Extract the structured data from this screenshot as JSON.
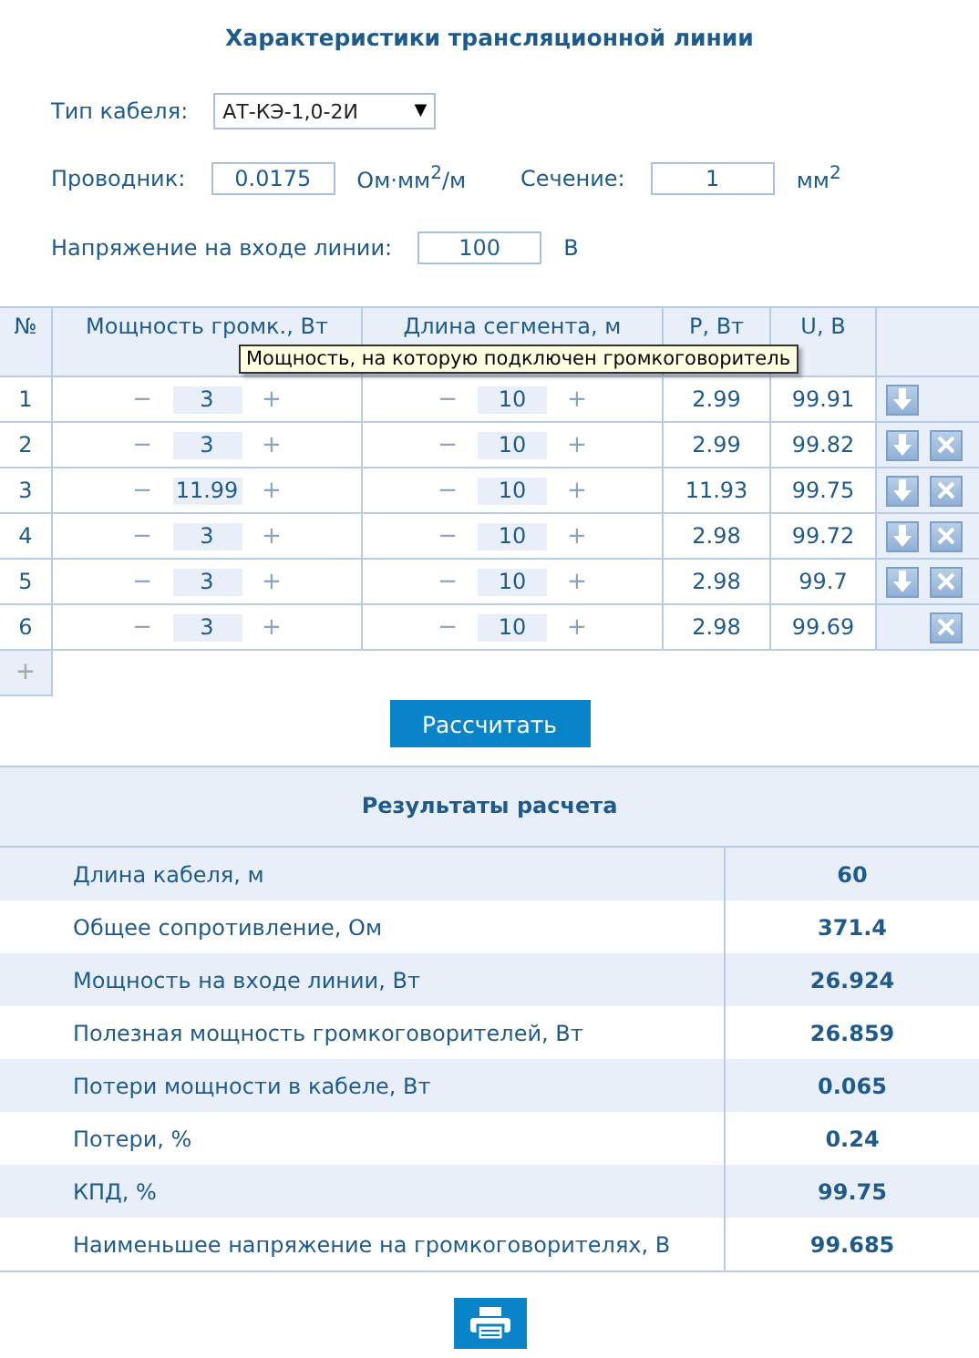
{
  "title": "Характеристики трансляционной линии",
  "cable": {
    "label": "Тип кабеля:",
    "value": "АТ-КЭ-1,0-2И",
    "caret": "▼"
  },
  "conductor": {
    "label": "Проводник:",
    "value": "0.0175",
    "unit": "Ом·мм$^{2}$/м"
  },
  "section": {
    "label": "Сечение:",
    "value": "1",
    "unit": "мм$^{2}$"
  },
  "voltage": {
    "label": "Напряжение на входе линии:",
    "value": "100",
    "unit": "В"
  },
  "table": {
    "columns": [
      "№",
      "Мощность громк., Вт",
      "Длина сегмента, м",
      "P, Вт",
      "U, В"
    ],
    "tooltip": "Мощность, на которую подключен громкоговоритель",
    "minus": "−",
    "plus": "+",
    "rows": [
      {
        "n": "1",
        "power": "3",
        "length": "10",
        "p": "2.99",
        "u": "99.91",
        "can_move_down": true,
        "can_delete": false
      },
      {
        "n": "2",
        "power": "3",
        "length": "10",
        "p": "2.99",
        "u": "99.82",
        "can_move_down": true,
        "can_delete": true
      },
      {
        "n": "3",
        "power": "11.99",
        "length": "10",
        "p": "11.93",
        "u": "99.75",
        "can_move_down": true,
        "can_delete": true
      },
      {
        "n": "4",
        "power": "3",
        "length": "10",
        "p": "2.98",
        "u": "99.72",
        "can_move_down": true,
        "can_delete": true
      },
      {
        "n": "5",
        "power": "3",
        "length": "10",
        "p": "2.98",
        "u": "99.7",
        "can_move_down": true,
        "can_delete": true
      },
      {
        "n": "6",
        "power": "3",
        "length": "10",
        "p": "2.98",
        "u": "99.69",
        "can_move_down": false,
        "can_delete": true
      }
    ],
    "add": "+"
  },
  "calculate_button": "Рассчитать",
  "results": {
    "title": "Результаты расчета",
    "rows": [
      {
        "label": "Длина кабеля, м",
        "value": "60"
      },
      {
        "label": "Общее сопротивление, Ом",
        "value": "371.4"
      },
      {
        "label": "Мощность на входе линии, Вт",
        "value": "26.924"
      },
      {
        "label": "Полезная мощность громкоговорителей, Вт",
        "value": "26.859"
      },
      {
        "label": "Потери мощности в кабеле, Вт",
        "value": "0.065"
      },
      {
        "label": "Потери, %",
        "value": "0.24"
      },
      {
        "label": "КПД, %",
        "value": "99.75"
      },
      {
        "label": "Наименьшее напряжение на громкоговорителях, В",
        "value": "99.685"
      }
    ]
  }
}
